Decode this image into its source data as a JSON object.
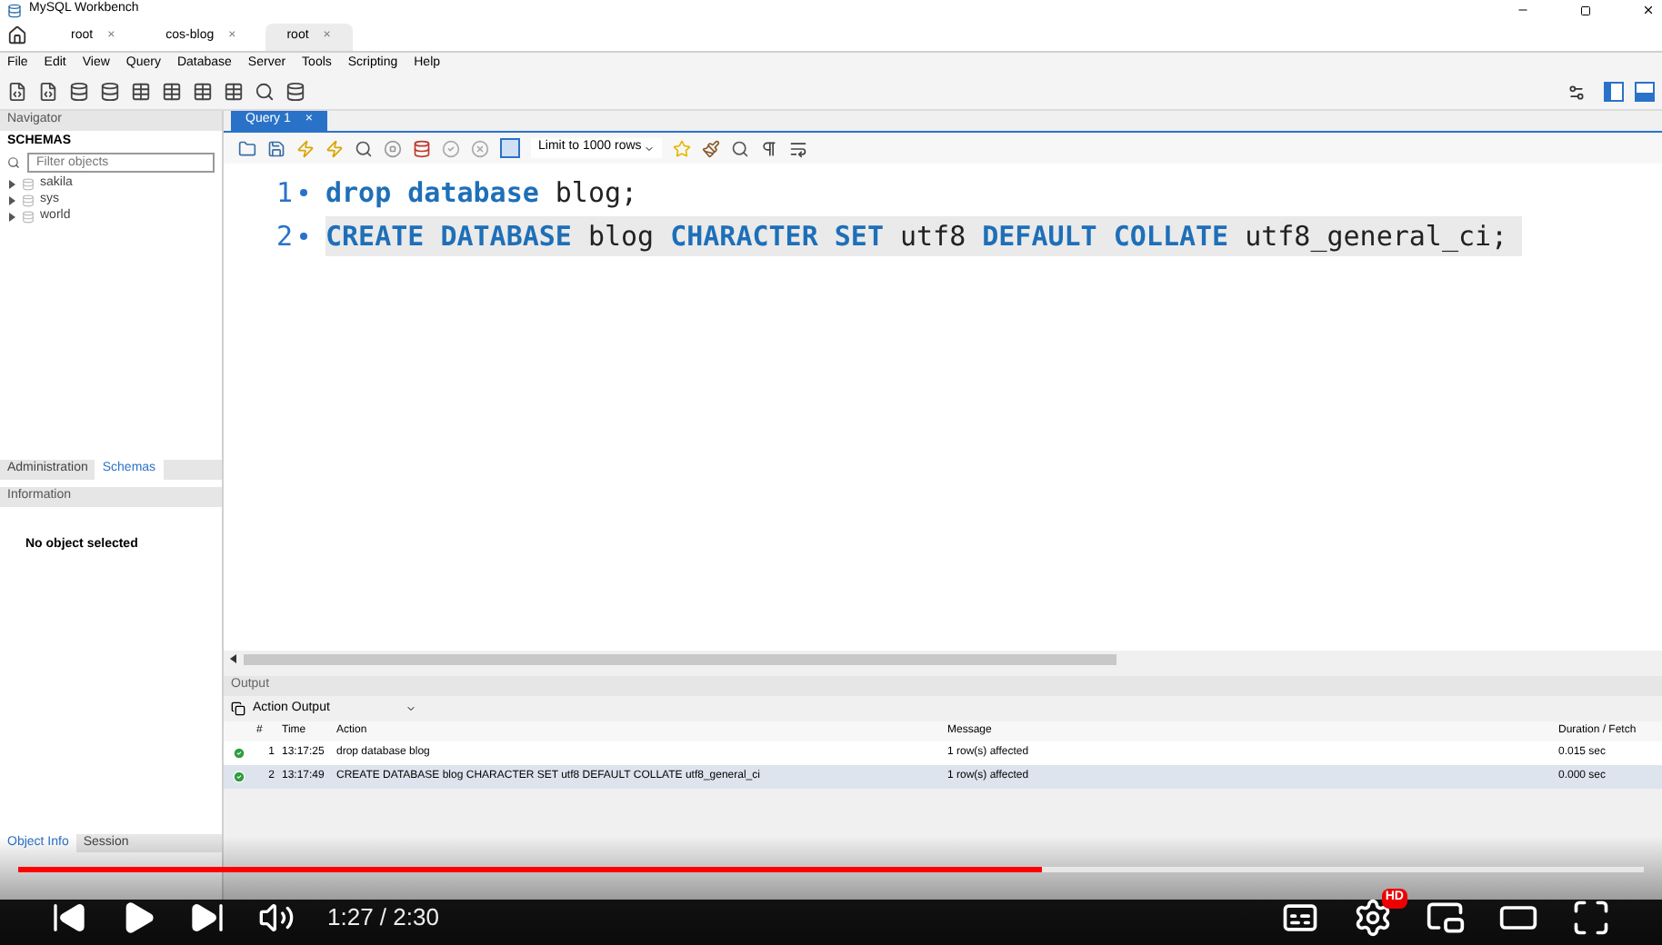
{
  "window": {
    "title": "MySQL Workbench"
  },
  "connection_tabs": [
    {
      "label": "root",
      "close": "×",
      "selected": false
    },
    {
      "label": "cos-blog",
      "close": "×",
      "selected": false
    },
    {
      "label": "root",
      "close": "×",
      "selected": true
    }
  ],
  "menu": [
    "File",
    "Edit",
    "View",
    "Query",
    "Database",
    "Server",
    "Tools",
    "Scripting",
    "Help"
  ],
  "navigator": {
    "title": "Navigator",
    "section": "SCHEMAS",
    "filter": {
      "placeholder": "Filter objects"
    },
    "schemas": [
      {
        "name": "sakila",
        "expanded": false
      },
      {
        "name": "sys",
        "expanded": false
      },
      {
        "name": "world",
        "expanded": false
      }
    ],
    "tabs": [
      {
        "label": "Administration",
        "selected": false
      },
      {
        "label": "Schemas",
        "selected": true
      }
    ],
    "information": {
      "title": "Information",
      "text": "No object selected"
    },
    "bottom_tabs": [
      {
        "label": "Object Info",
        "selected": true
      },
      {
        "label": "Session",
        "selected": false
      }
    ]
  },
  "query_tab": {
    "label": "Query 1",
    "close": "×"
  },
  "limit": "Limit to 1000 rows",
  "editor": {
    "lines": [
      {
        "number": "1",
        "current": false,
        "tokens": [
          {
            "kind": "keyword",
            "text": "drop database"
          },
          {
            "kind": "plain",
            "text": "blog;"
          }
        ]
      },
      {
        "number": "2",
        "current": true,
        "tokens": [
          {
            "kind": "keyword",
            "text": "CREATE DATABASE"
          },
          {
            "kind": "plain",
            "text": "blog"
          },
          {
            "kind": "keyword",
            "text": "CHARACTER SET"
          },
          {
            "kind": "plain",
            "text": "utf8"
          },
          {
            "kind": "keyword",
            "text": "DEFAULT COLLATE"
          },
          {
            "kind": "plain",
            "text": "utf8_general_ci;"
          }
        ]
      }
    ]
  },
  "output": {
    "title": "Output",
    "mode": "Action Output",
    "columns": [
      "#",
      "Time",
      "Action",
      "Message",
      "Duration / Fetch"
    ],
    "rows": [
      {
        "success": true,
        "selected": false,
        "cells": [
          "1",
          "13:17:25",
          "drop database blog",
          "1 row(s) affected",
          "0.015 sec"
        ]
      },
      {
        "success": true,
        "selected": true,
        "cells": [
          "2",
          "13:17:49",
          "CREATE DATABASE blog CHARACTER SET utf8 DEFAULT COLLATE utf8_general_ci",
          "1 row(s) affected",
          "0.000 sec"
        ]
      }
    ]
  },
  "player": {
    "level": 0.63,
    "time": "1:27 / 2:30",
    "hd": "HD"
  }
}
